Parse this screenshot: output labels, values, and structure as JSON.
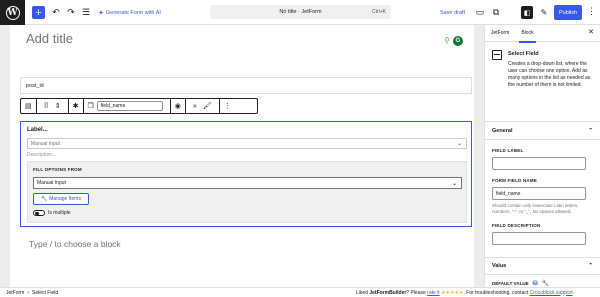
{
  "topbar": {
    "add_icon": "plus-icon",
    "generate_label": "Generate Form with AI",
    "doc_title": "No title · JetForm",
    "shortcut": "Ctrl+K",
    "save_draft": "Save draft",
    "publish": "Publish"
  },
  "editor": {
    "title_placeholder": "Add title",
    "post_id_text": "post_id",
    "block_toolbar": {
      "field_name_value": "field_name"
    },
    "select_field": {
      "label": "Label...",
      "select_value": "Manual Input",
      "description": "Description...",
      "fill_options_label": "FILL OPTIONS FROM",
      "fill_options_value": "Manual Input",
      "manage_items": "Manage Items",
      "is_multiple": "Is multiple"
    },
    "appender_placeholder": "Type / to choose a block"
  },
  "sidebar": {
    "tabs": [
      "JetForm",
      "Block"
    ],
    "active_tab": "Block",
    "block_title": "Select Field",
    "block_desc": "Creates a drop-down list, where the user can choose one option. Add as many options in the list as needed as the number of them is not limited.",
    "general_title": "General",
    "field_label_label": "FIELD LABEL",
    "field_label_value": "",
    "form_field_name_label": "FORM FIELD NAME",
    "form_field_name_value": "field_name",
    "form_field_name_help": "Should contain only lowercase Latin letters, numbers, \"-\", or \"_\". No spaces allowed.",
    "field_description_label": "FIELD DESCRIPTION",
    "field_description_value": "",
    "value_title": "Value",
    "default_value_label": "DEFAULT VALUE"
  },
  "footer": {
    "breadcrumb": [
      "JetForm",
      "Select Field"
    ],
    "liked_prefix": "Liked ",
    "liked_brand": "JetFormBuilder",
    "liked_mid": "? Please ",
    "rate_link": "rate it",
    "stars": "★★★★★",
    "support_prefix": ". For troubleshooting, contact ",
    "support_link": "Crocoblock support",
    "support_suffix": "."
  },
  "colors": {
    "accent": "#3858e9",
    "dark": "#1e1e1e",
    "canvas_bg": "#ececec"
  }
}
